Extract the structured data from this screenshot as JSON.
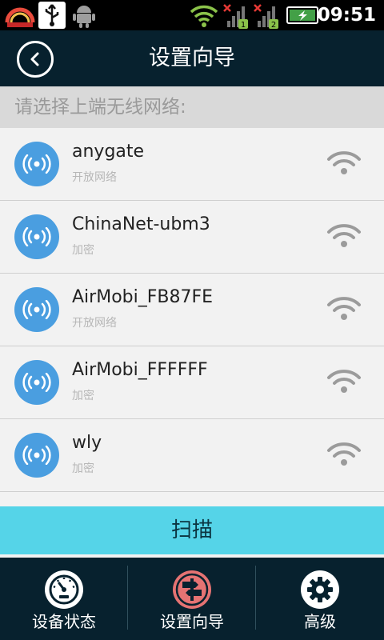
{
  "status_bar": {
    "time": "09:51",
    "icons": [
      "speed-widget-icon",
      "usb-icon",
      "android-debug-icon",
      "wifi-signal-icon",
      "cell-signal-1-icon",
      "cell-signal-2-icon",
      "battery-charging-icon"
    ],
    "sig1_label": "1",
    "sig2_label": "2"
  },
  "header": {
    "title": "设置向导",
    "back_icon": "back-arrow-icon"
  },
  "section": {
    "title": "请选择上端无线网络:"
  },
  "networks": [
    {
      "name": "anygate",
      "security": "开放网络"
    },
    {
      "name": "ChinaNet-ubm3",
      "security": "加密"
    },
    {
      "name": "AirMobi_FB87FE",
      "security": "开放网络"
    },
    {
      "name": "AirMobi_FFFFFF",
      "security": "加密"
    },
    {
      "name": "wly",
      "security": "加密"
    }
  ],
  "scan_button": {
    "label": "扫描"
  },
  "bottom_nav": {
    "tabs": [
      {
        "label": "设备状态",
        "icon": "speedometer-icon",
        "active": false
      },
      {
        "label": "设置向导",
        "icon": "signpost-icon",
        "active": true
      },
      {
        "label": "高级",
        "icon": "gear-icon",
        "active": false
      }
    ]
  },
  "colors": {
    "header_bg": "#07212e",
    "accent": "#55d4e8",
    "network_circle": "#4a9ee0",
    "active_tab": "#e57373"
  }
}
